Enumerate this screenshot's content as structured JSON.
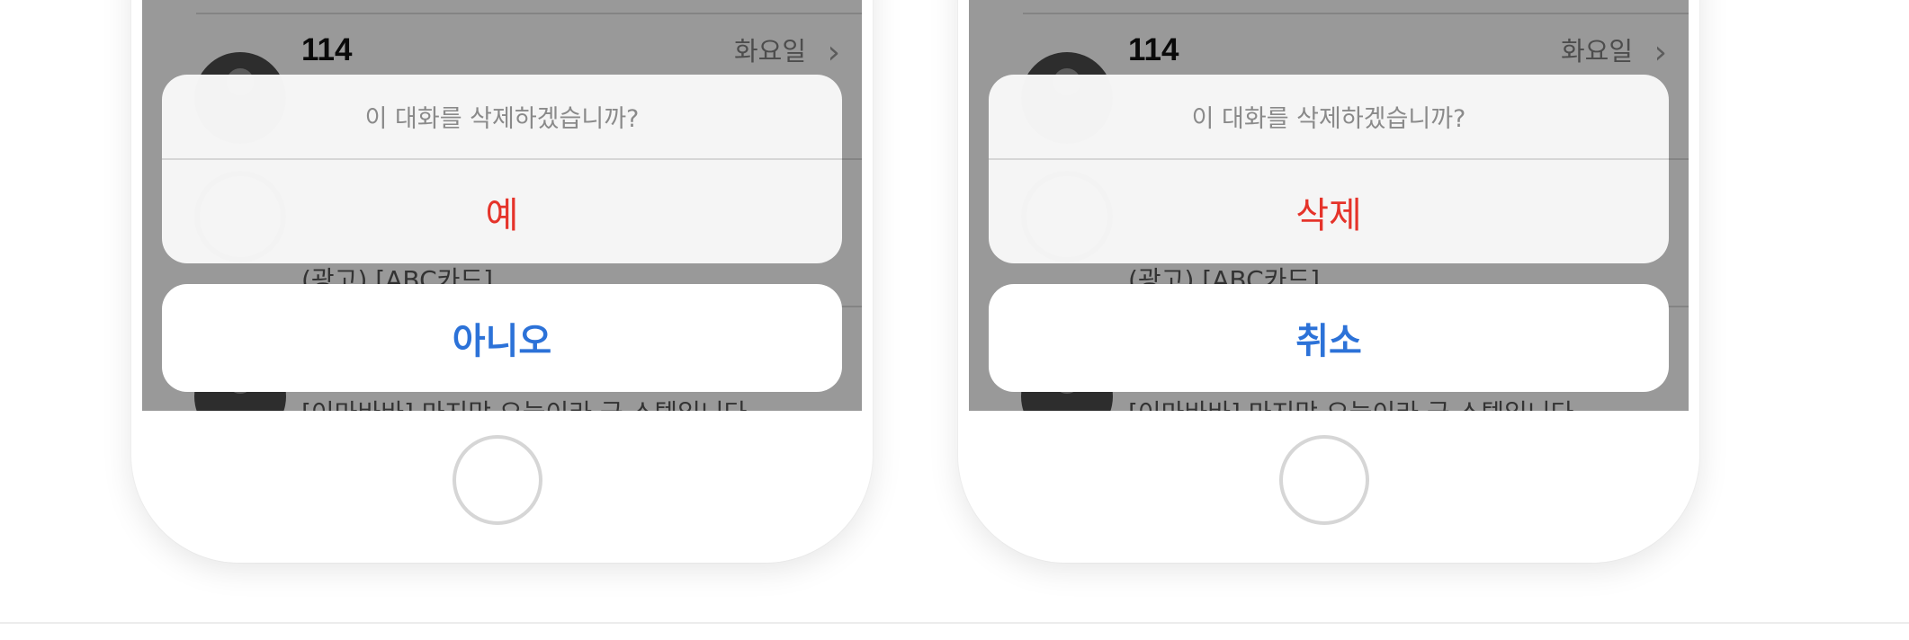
{
  "phones": [
    {
      "messages": [
        {
          "sender": "114",
          "time": "화요일",
          "preview": ""
        },
        {
          "sender": "",
          "time": "",
          "preview": "(광고) [ABC카드]"
        },
        {
          "sender": "",
          "time": "",
          "preview": "[이마바바] 마지막 오늘이라 금 스텝입니다"
        }
      ],
      "action_sheet": {
        "title": "이 대화를 삭제하겠습니까?",
        "destructive_label": "예"
      },
      "cancel_label": "아니오"
    },
    {
      "messages": [
        {
          "sender": "114",
          "time": "화요일",
          "preview": ""
        },
        {
          "sender": "",
          "time": "",
          "preview": "(광고) [ABC카드]"
        },
        {
          "sender": "",
          "time": "",
          "preview": "[이마바바] 마지막 오늘이라 금 스텝입니다"
        }
      ],
      "action_sheet": {
        "title": "이 대화를 삭제하겠습니까?",
        "destructive_label": "삭제"
      },
      "cancel_label": "취소"
    }
  ],
  "colors": {
    "destructive": "#e5332a",
    "cancel": "#2c72d8",
    "overlay": "rgba(0,0,0,0.40)"
  },
  "icons": {
    "chevron": "›"
  }
}
